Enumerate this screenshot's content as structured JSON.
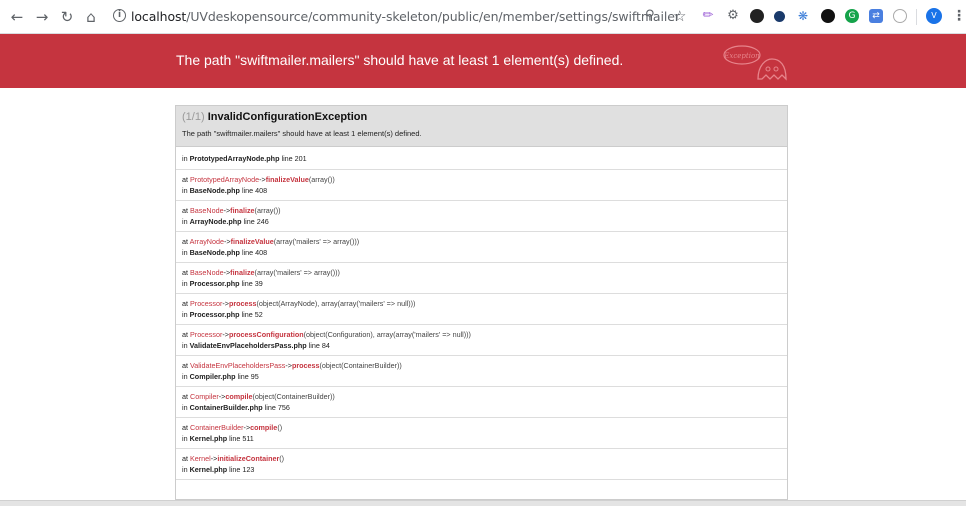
{
  "browser": {
    "url_host": "localhost",
    "url_path": "/UVdeskopensource/community-skeleton/public/en/member/settings/swiftmailer",
    "icons": [
      "back-icon",
      "forward-icon",
      "reload-icon",
      "home-icon",
      "info-icon",
      "zoom-icon",
      "star-icon"
    ],
    "profile_initial": "V"
  },
  "exception": {
    "header_message": "The path \"swiftmailer.mailers\" should have at least 1 element(s) defined.",
    "ghost_label": "Exception",
    "count": "(1/1)",
    "name": "InvalidConfigurationException",
    "message": "The path \"swiftmailer.mailers\" should have at least 1 element(s) defined."
  },
  "trace": [
    {
      "single": true,
      "in": "in",
      "file": "PrototypedArrayNode.php",
      "line": "line 201"
    },
    {
      "at": "at",
      "cls": "PrototypedArrayNode",
      "arrow": "->",
      "fn": "finalizeValue",
      "args": "(array())",
      "in": "in",
      "file": "BaseNode.php",
      "line": "line 408"
    },
    {
      "at": "at",
      "cls": "BaseNode",
      "arrow": "->",
      "fn": "finalize",
      "args": "(array())",
      "in": "in",
      "file": "ArrayNode.php",
      "line": "line 246"
    },
    {
      "at": "at",
      "cls": "ArrayNode",
      "arrow": "->",
      "fn": "finalizeValue",
      "args": "(array('mailers' => array()))",
      "in": "in",
      "file": "BaseNode.php",
      "line": "line 408"
    },
    {
      "at": "at",
      "cls": "BaseNode",
      "arrow": "->",
      "fn": "finalize",
      "args": "(array('mailers' => array()))",
      "in": "in",
      "file": "Processor.php",
      "line": "line 39"
    },
    {
      "at": "at",
      "cls": "Processor",
      "arrow": "->",
      "fn": "process",
      "args": "(object(ArrayNode), array(array('mailers' => null)))",
      "in": "in",
      "file": "Processor.php",
      "line": "line 52"
    },
    {
      "at": "at",
      "cls": "Processor",
      "arrow": "->",
      "fn": "processConfiguration",
      "args": "(object(Configuration), array(array('mailers' => null)))",
      "in": "in",
      "file": "ValidateEnvPlaceholdersPass.php",
      "line": "line 84"
    },
    {
      "at": "at",
      "cls": "ValidateEnvPlaceholdersPass",
      "arrow": "->",
      "fn": "process",
      "args": "(object(ContainerBuilder))",
      "in": "in",
      "file": "Compiler.php",
      "line": "line 95"
    },
    {
      "at": "at",
      "cls": "Compiler",
      "arrow": "->",
      "fn": "compile",
      "args": "(object(ContainerBuilder))",
      "in": "in",
      "file": "ContainerBuilder.php",
      "line": "line 756"
    },
    {
      "at": "at",
      "cls": "ContainerBuilder",
      "arrow": "->",
      "fn": "compile",
      "args": "()",
      "in": "in",
      "file": "Kernel.php",
      "line": "line 511"
    },
    {
      "at": "at",
      "cls": "Kernel",
      "arrow": "->",
      "fn": "initializeContainer",
      "args": "()",
      "in": "in",
      "file": "Kernel.php",
      "line": "line 123"
    }
  ]
}
